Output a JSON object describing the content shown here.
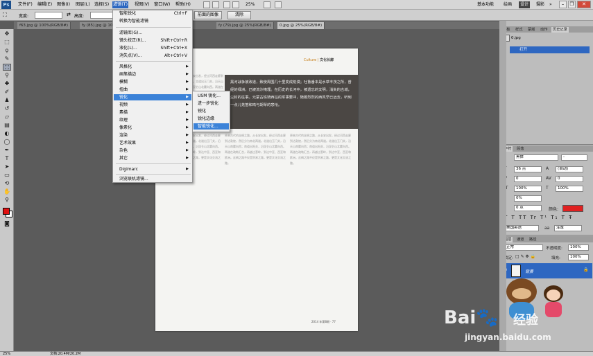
{
  "menubar": {
    "app_icon": "Ps",
    "items": [
      "文件(F)",
      "编辑(E)",
      "图像(I)",
      "图层(L)",
      "选择(S)",
      "滤镜(T)",
      "视图(V)",
      "窗口(W)",
      "帮助(H)"
    ],
    "zoom": "25%",
    "workspaces": [
      "基本功能",
      "绘画",
      "设计",
      "摄影"
    ],
    "active_workspace": "设计",
    "more": "»"
  },
  "options": {
    "width_label": "宽度:",
    "height_label": "高度:",
    "front_image_btn": "前面的图像",
    "clear_btn": "清除",
    "width_value": "",
    "height_value": ""
  },
  "tabs": [
    {
      "label": "f63.jpg @ 100%(RGB/8#)"
    },
    {
      "label": "fy (85).jpg @ 100%(RGB/8#)"
    },
    {
      "label": "fy (79).jpg @ 25%(RGB/8#)"
    },
    {
      "label": "0.jpg @ 25%(RGB/8#)"
    }
  ],
  "filter_menu": {
    "items": [
      {
        "label": "智能锐化",
        "shortcut": "Ctrl+F"
      },
      {
        "label": "转换为智能滤镜"
      },
      {
        "label": "滤镜库(G)..."
      },
      {
        "label": "镜头校正(R)...",
        "shortcut": "Shift+Ctrl+R"
      },
      {
        "label": "液化(L)...",
        "shortcut": "Shift+Ctrl+X"
      },
      {
        "label": "消失点(V)...",
        "shortcut": "Alt+Ctrl+V"
      },
      {
        "label": "风格化"
      },
      {
        "label": "画笔描边"
      },
      {
        "label": "模糊"
      },
      {
        "label": "扭曲"
      },
      {
        "label": "锐化"
      },
      {
        "label": "视频"
      },
      {
        "label": "素描"
      },
      {
        "label": "纹理"
      },
      {
        "label": "像素化"
      },
      {
        "label": "渲染"
      },
      {
        "label": "艺术效果"
      },
      {
        "label": "杂色"
      },
      {
        "label": "其它"
      },
      {
        "label": "Digimarc"
      },
      {
        "label": "浏览联机滤镜..."
      }
    ]
  },
  "sharpen_submenu": {
    "items": [
      "USM 锐化...",
      "进一步锐化",
      "锐化",
      "锐化边缘",
      "智能锐化..."
    ]
  },
  "document": {
    "section_tag": "Culture",
    "section_name": "文化长廊",
    "dark_text": "黑河战争被改道，致使周围几十里变成荒漠；吐鲁番本是水草丰茂之所，曾经的绿洲，已被流沙掩埋。在历史的长河中，被遗忘的文明，消失的古城，尘封的往事。元蒙古铁骑西征的军事要冲，随着烈烈的西风早已远去，听到一点儿羌笛和鸣与胡琴的悲怆。",
    "footer": "2014 年第8期 · 77",
    "body_text": "原来古代的丝绸之路，从长安出发，经过河西走廊到达敦煌，然后分为南北两道。北道出玉门关，沿天山南麓向西；南道出阳关，沿昆仑山北麓向西。两道在疏勒汇合，再越过葱岭，到达中亚、西亚和欧洲。丝绸之路不仅是贸易之路，更是文化交流之路。"
  },
  "panels": {
    "top_tabs": [
      "色板",
      "样式",
      "蒙版",
      "动作",
      "历史记录"
    ],
    "history_file": "0.jpg",
    "history_step": "打开",
    "char_tabs": [
      "字符",
      "段落"
    ],
    "font_family": "黑体",
    "font_style": "-",
    "font_size": "36 点",
    "leading": "(自动)",
    "tracking_left": "0",
    "tracking_right": "0",
    "scale_v": "100%",
    "scale_h": "100%",
    "kern": "0%",
    "baseline": "0 点",
    "color_label": "颜色:",
    "language": "美国英语",
    "aa": "aa",
    "aa_mode": "浑厚",
    "layer_tabs": [
      "图层",
      "通道",
      "路径"
    ],
    "blend_mode": "正常",
    "opacity_label": "不透明度:",
    "opacity": "100%",
    "lock_label": "锁定:",
    "fill_label": "填充:",
    "fill": "100%",
    "layer_name": "背景"
  },
  "status": {
    "zoom": "25%",
    "doc": "文档:20.4M/20.2M"
  },
  "watermark": {
    "brand": "Bai",
    "brand2": "经验",
    "url": "jingyan.baidu.com"
  },
  "colors": {
    "accent": "#2b66c0",
    "foreground": "#e01010",
    "swatch_color": "#e02020",
    "culture": "#c47a10"
  }
}
